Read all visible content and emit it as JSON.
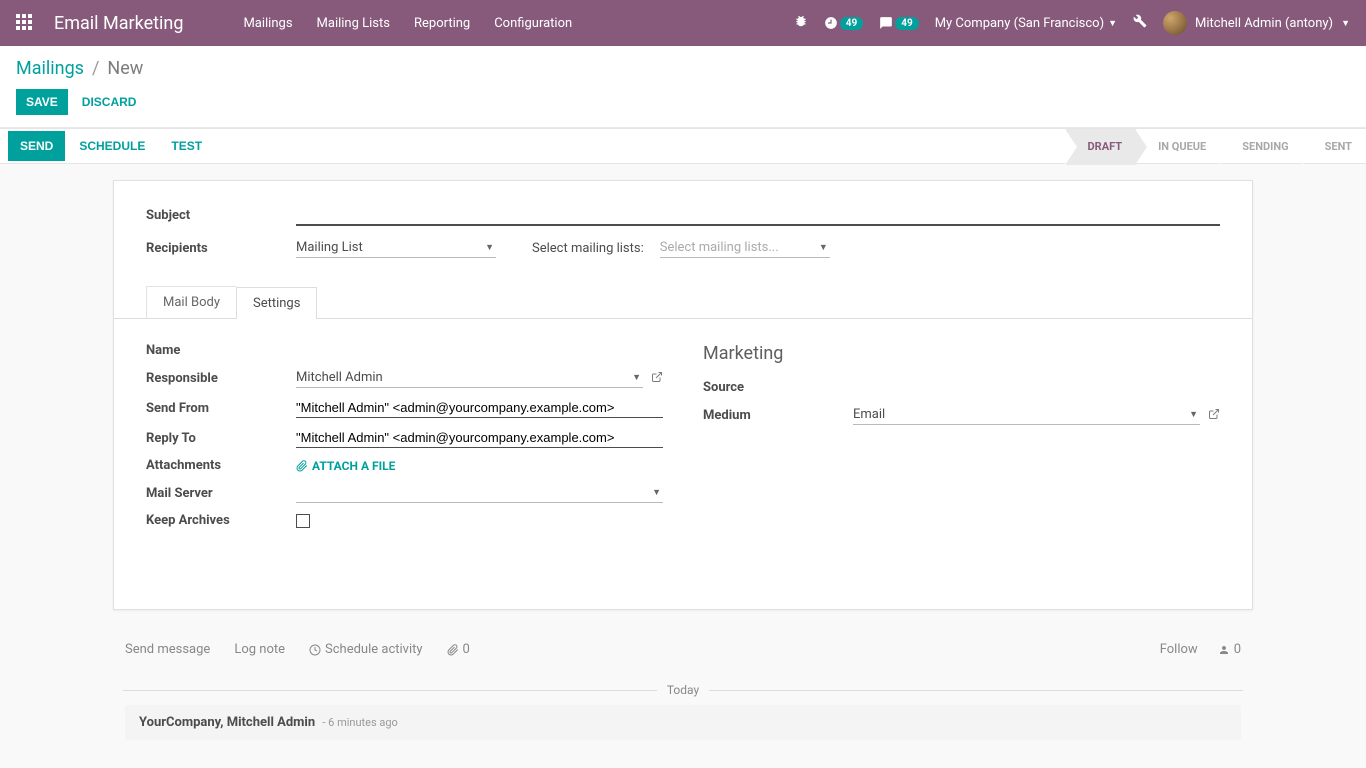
{
  "nav": {
    "brand": "Email Marketing",
    "menu": [
      "Mailings",
      "Mailing Lists",
      "Reporting",
      "Configuration"
    ],
    "badge1": "49",
    "badge2": "49",
    "company": "My Company (San Francisco)",
    "user": "Mitchell Admin (antony)"
  },
  "breadcrumb": {
    "root": "Mailings",
    "current": "New"
  },
  "buttons": {
    "save": "SAVE",
    "discard": "DISCARD"
  },
  "status": {
    "send": "SEND",
    "schedule": "SCHEDULE",
    "test": "TEST",
    "stages": [
      "DRAFT",
      "IN QUEUE",
      "SENDING",
      "SENT"
    ],
    "active": 0
  },
  "form": {
    "subject_label": "Subject",
    "recipients_label": "Recipients",
    "recipients_value": "Mailing List",
    "ml_label": "Select mailing lists:",
    "ml_placeholder": "Select mailing lists...",
    "tabs": [
      "Mail Body",
      "Settings"
    ],
    "settings": {
      "name_label": "Name",
      "responsible_label": "Responsible",
      "responsible_value": "Mitchell Admin",
      "sendfrom_label": "Send From",
      "sendfrom_value": "\"Mitchell Admin\" <admin@yourcompany.example.com>",
      "replyto_label": "Reply To",
      "replyto_value": "\"Mitchell Admin\" <admin@yourcompany.example.com>",
      "attachments_label": "Attachments",
      "attach_action": "ATTACH A FILE",
      "mailserver_label": "Mail Server",
      "keeparchives_label": "Keep Archives",
      "marketing_header": "Marketing",
      "source_label": "Source",
      "medium_label": "Medium",
      "medium_value": "Email"
    }
  },
  "chatter": {
    "send_msg": "Send message",
    "log_note": "Log note",
    "schedule_activity": "Schedule activity",
    "attach_count": "0",
    "follow": "Follow",
    "followers": "0",
    "today": "Today",
    "msg_author": "YourCompany, Mitchell Admin",
    "msg_time": "- 6 minutes ago"
  }
}
